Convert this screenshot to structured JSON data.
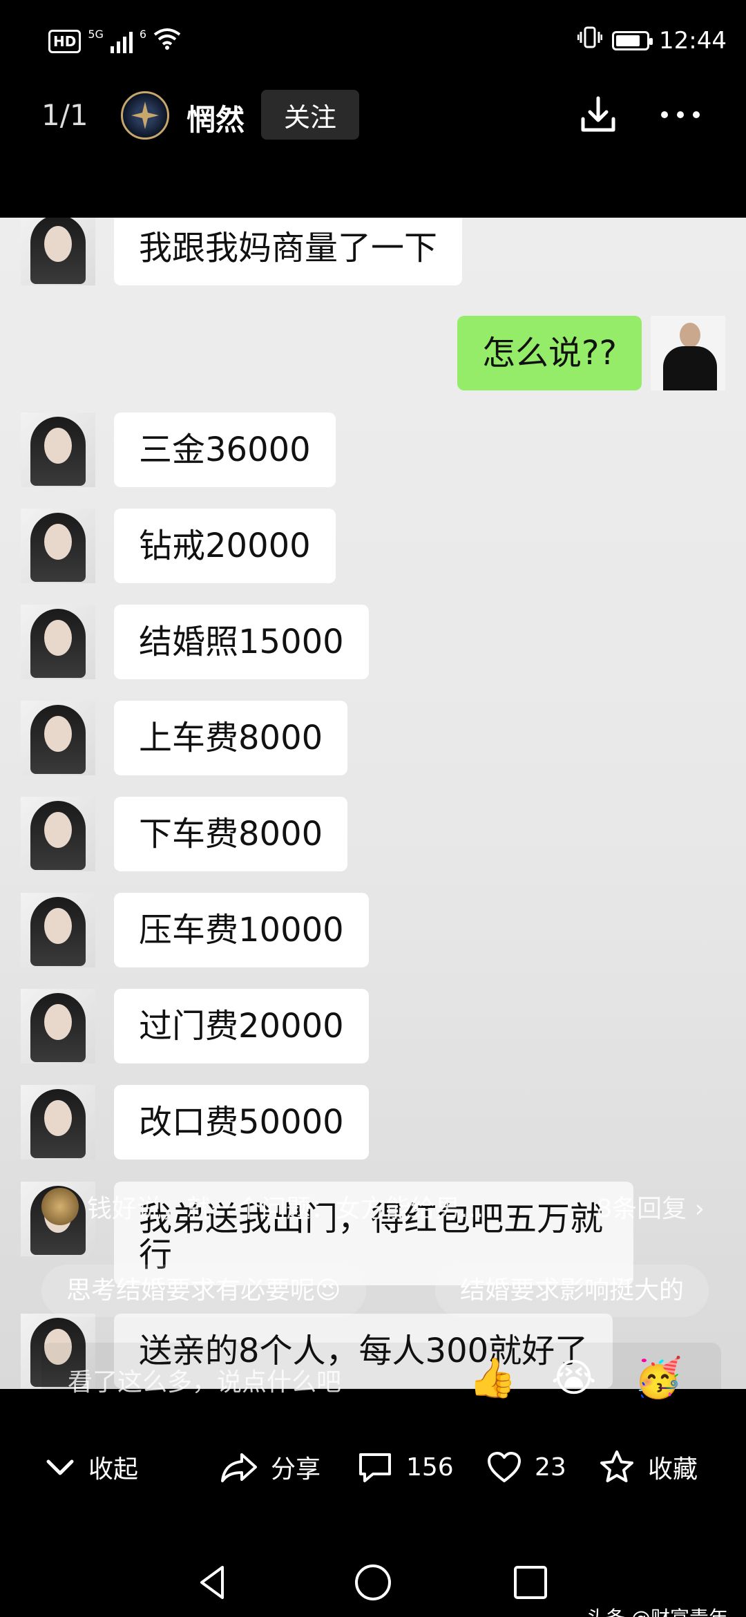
{
  "status_bar": {
    "hd_label": "HD",
    "network_1": "5G",
    "network_2": "6",
    "time": "12:44"
  },
  "top_bar": {
    "page_counter": "1/1",
    "author_name": "惘然",
    "follow_label": "关注"
  },
  "chat": {
    "messages": [
      {
        "side": "left",
        "text": "我跟我妈商量了一下"
      },
      {
        "side": "right",
        "text": "怎么说??"
      },
      {
        "side": "left",
        "text": "三金36000"
      },
      {
        "side": "left",
        "text": "钻戒20000"
      },
      {
        "side": "left",
        "text": "结婚照15000"
      },
      {
        "side": "left",
        "text": "上车费8000"
      },
      {
        "side": "left",
        "text": "下车费8000"
      },
      {
        "side": "left",
        "text": "压车费10000"
      },
      {
        "side": "left",
        "text": "过门费20000"
      },
      {
        "side": "left",
        "text": "改口费50000"
      },
      {
        "side": "left",
        "text": "我弟送我出门，得红包吧五万就行"
      },
      {
        "side": "left",
        "text": "送亲的8个人，每人300就好了"
      }
    ]
  },
  "top_comment": {
    "text": "钱好说，就一个问题：女方能给男...",
    "replies": "8条回复"
  },
  "suggestions": [
    "思考结婚要求有必要呢😉",
    "结婚要求影响挺大的"
  ],
  "comment_input": {
    "placeholder": "看了这么多，说点什么吧",
    "emojis": [
      "👍",
      "😭",
      "🥳"
    ]
  },
  "actions": {
    "collapse": "收起",
    "share": "分享",
    "comments": "156",
    "likes": "23",
    "favorite": "收藏"
  },
  "watermark": "头条 @财富青年"
}
